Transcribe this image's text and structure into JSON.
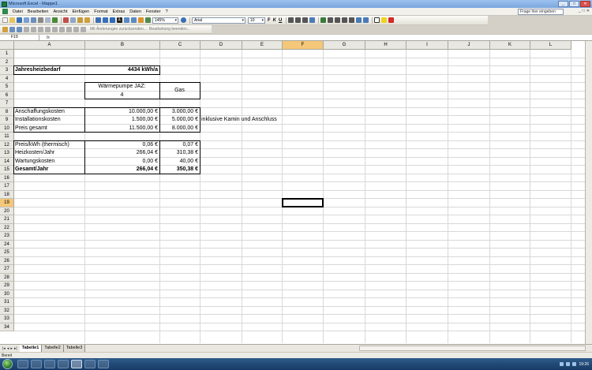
{
  "window": {
    "title": "Microsoft Excel - Mappe1"
  },
  "menu": {
    "items": [
      "Datei",
      "Bearbeiten",
      "Ansicht",
      "Einfügen",
      "Format",
      "Extras",
      "Daten",
      "Fenster",
      "?"
    ],
    "help_placeholder": "Frage hier eingeben"
  },
  "toolbar": {
    "zoom": "145%",
    "font_name": "Arial",
    "font_size": "10",
    "bold": "F",
    "italic": "K",
    "underline": "U",
    "review_reply": "Mit Änderungen zurücksenden...",
    "review_end": "Bearbeitung beenden..."
  },
  "formula_bar": {
    "name_box": "F19",
    "fx": "fx",
    "content": ""
  },
  "columns": [
    "A",
    "B",
    "C",
    "D",
    "E",
    "F",
    "G",
    "H",
    "I",
    "J",
    "K",
    "L"
  ],
  "selected_column": "F",
  "selected_row": 19,
  "row_count": 34,
  "cells": {
    "A3": "Jahresheizbedarf",
    "B3": "4434 kWh/a",
    "B5": "Wärmepumpe JAZ:",
    "B6": "4",
    "C5": "Gas",
    "A8": "Anschaffungskosten",
    "B8": "10.000,00 €",
    "C8": "3.000,00 €",
    "A9": "Installationskosten",
    "B9": "1.500,00 €",
    "C9": "5.000,00 €",
    "D9": "inklusive Kamin und Anschluss",
    "A10": "Preis gesamt",
    "B10": "11.500,00 €",
    "C10": "8.000,00 €",
    "A12": "Preis/kWh (thermisch)",
    "B12": "0,06 €",
    "C12": "0,07 €",
    "A13": "Heizkosten/Jahr",
    "B13": "266,04 €",
    "C13": "310,38 €",
    "A14": "Wartungskosten",
    "B14": "0,00 €",
    "C14": "40,00 €",
    "A15": "Gesamt/Jahr",
    "B15": "266,04 €",
    "C15": "350,38 €"
  },
  "sheets": [
    "Tabelle1",
    "Tabelle2",
    "Tabelle3"
  ],
  "active_sheet": "Tabelle1",
  "status": "Bereit",
  "clock": "19:26"
}
